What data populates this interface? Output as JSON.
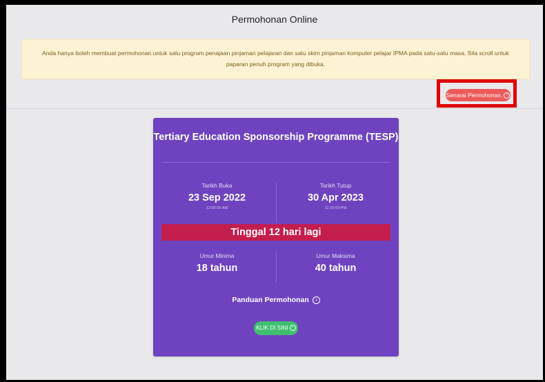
{
  "header": {
    "title": "Permohonan Online"
  },
  "notice": {
    "text": "Anda hanya boleh membuat permohonan untuk satu program penajaan pinjaman pelajaran dan satu skim pinjaman komputer pelajar IPMA pada satu-satu masa. Sila scroll untuk paparan penuh program yang dibuka."
  },
  "actions": {
    "list_button_label": "Senarai Permohonan.",
    "list_button_icon": "arrow-circle-icon"
  },
  "program": {
    "title": "Tertiary Education Sponsorship Programme (TESP)",
    "open": {
      "label": "Tarikh Buka",
      "date": "23 Sep 2022",
      "time": "12:00:00 AM"
    },
    "close": {
      "label": "Tarikh Tutup",
      "date": "30 Apr 2023",
      "time": "11:59:59 PM"
    },
    "countdown": "Tinggal 12 hari lagi",
    "age_min": {
      "label": "Umur Minima",
      "value": "18 tahun"
    },
    "age_max": {
      "label": "Umur Maksima",
      "value": "40 tahun"
    },
    "guide_label": "Panduan Permohonan",
    "click_label": "KLIK DI SINI"
  },
  "colors": {
    "card": "#6f43c0",
    "countdown": "#c41e4d",
    "list_button": "#ec5a5a",
    "click_button": "#3fbf6f",
    "highlight": "#e00000",
    "notice_bg": "#fdf3d4"
  }
}
